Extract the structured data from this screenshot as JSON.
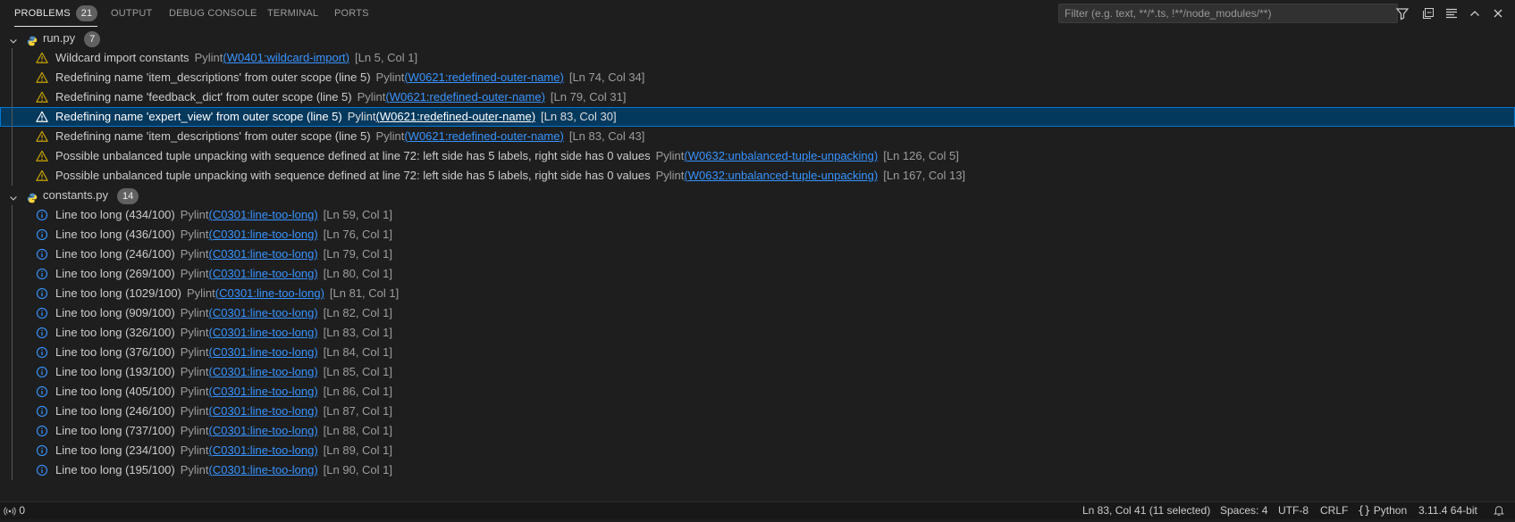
{
  "tabs": [
    {
      "label": "PROBLEMS",
      "badge": "21",
      "active": true
    },
    {
      "label": "OUTPUT"
    },
    {
      "label": "DEBUG CONSOLE"
    },
    {
      "label": "TERMINAL"
    },
    {
      "label": "PORTS"
    }
  ],
  "filter": {
    "placeholder": "Filter (e.g. text, **/*.ts, !**/node_modules/**)",
    "value": ""
  },
  "header_icons": [
    "filter-icon",
    "collapse-all-icon",
    "view-as-list-icon",
    "maximize-panel-icon",
    "close-panel-icon"
  ],
  "files": [
    {
      "name": "run.py",
      "count": "7",
      "expanded": true,
      "problems": [
        {
          "severity": "warning",
          "message": "Wildcard import constants",
          "source": "Pylint",
          "code": "W0401:wildcard-import",
          "location": "[Ln 5, Col 1]"
        },
        {
          "severity": "warning",
          "message": "Redefining name 'item_descriptions' from outer scope (line 5)",
          "source": "Pylint",
          "code": "W0621:redefined-outer-name",
          "location": "[Ln 74, Col 34]"
        },
        {
          "severity": "warning",
          "message": "Redefining name 'feedback_dict' from outer scope (line 5)",
          "source": "Pylint",
          "code": "W0621:redefined-outer-name",
          "location": "[Ln 79, Col 31]"
        },
        {
          "severity": "warning",
          "message": "Redefining name 'expert_view' from outer scope (line 5)",
          "source": "Pylint",
          "code": "W0621:redefined-outer-name",
          "location": "[Ln 83, Col 30]",
          "selected": true
        },
        {
          "severity": "warning",
          "message": "Redefining name 'item_descriptions' from outer scope (line 5)",
          "source": "Pylint",
          "code": "W0621:redefined-outer-name",
          "location": "[Ln 83, Col 43]"
        },
        {
          "severity": "warning",
          "message": "Possible unbalanced tuple unpacking with sequence defined at line 72: left side has 5 labels, right side has 0 values",
          "source": "Pylint",
          "code": "W0632:unbalanced-tuple-unpacking",
          "location": "[Ln 126, Col 5]"
        },
        {
          "severity": "warning",
          "message": "Possible unbalanced tuple unpacking with sequence defined at line 72: left side has 5 labels, right side has 0 values",
          "source": "Pylint",
          "code": "W0632:unbalanced-tuple-unpacking",
          "location": "[Ln 167, Col 13]"
        }
      ]
    },
    {
      "name": "constants.py",
      "count": "14",
      "expanded": true,
      "problems": [
        {
          "severity": "info",
          "message": "Line too long (434/100)",
          "source": "Pylint",
          "code": "C0301:line-too-long",
          "location": "[Ln 59, Col 1]"
        },
        {
          "severity": "info",
          "message": "Line too long (436/100)",
          "source": "Pylint",
          "code": "C0301:line-too-long",
          "location": "[Ln 76, Col 1]"
        },
        {
          "severity": "info",
          "message": "Line too long (246/100)",
          "source": "Pylint",
          "code": "C0301:line-too-long",
          "location": "[Ln 79, Col 1]"
        },
        {
          "severity": "info",
          "message": "Line too long (269/100)",
          "source": "Pylint",
          "code": "C0301:line-too-long",
          "location": "[Ln 80, Col 1]"
        },
        {
          "severity": "info",
          "message": "Line too long (1029/100)",
          "source": "Pylint",
          "code": "C0301:line-too-long",
          "location": "[Ln 81, Col 1]"
        },
        {
          "severity": "info",
          "message": "Line too long (909/100)",
          "source": "Pylint",
          "code": "C0301:line-too-long",
          "location": "[Ln 82, Col 1]"
        },
        {
          "severity": "info",
          "message": "Line too long (326/100)",
          "source": "Pylint",
          "code": "C0301:line-too-long",
          "location": "[Ln 83, Col 1]"
        },
        {
          "severity": "info",
          "message": "Line too long (376/100)",
          "source": "Pylint",
          "code": "C0301:line-too-long",
          "location": "[Ln 84, Col 1]"
        },
        {
          "severity": "info",
          "message": "Line too long (193/100)",
          "source": "Pylint",
          "code": "C0301:line-too-long",
          "location": "[Ln 85, Col 1]"
        },
        {
          "severity": "info",
          "message": "Line too long (405/100)",
          "source": "Pylint",
          "code": "C0301:line-too-long",
          "location": "[Ln 86, Col 1]"
        },
        {
          "severity": "info",
          "message": "Line too long (246/100)",
          "source": "Pylint",
          "code": "C0301:line-too-long",
          "location": "[Ln 87, Col 1]"
        },
        {
          "severity": "info",
          "message": "Line too long (737/100)",
          "source": "Pylint",
          "code": "C0301:line-too-long",
          "location": "[Ln 88, Col 1]"
        },
        {
          "severity": "info",
          "message": "Line too long (234/100)",
          "source": "Pylint",
          "code": "C0301:line-too-long",
          "location": "[Ln 89, Col 1]"
        },
        {
          "severity": "info",
          "message": "Line too long (195/100)",
          "source": "Pylint",
          "code": "C0301:line-too-long",
          "location": "[Ln 90, Col 1]"
        }
      ]
    }
  ],
  "statusbar": {
    "ports": "0",
    "cursor": "Ln 83, Col 41 (11 selected)",
    "spaces": "Spaces: 4",
    "encoding": "UTF-8",
    "eol": "CRLF",
    "language": "Python",
    "interpreter": "3.11.4 64-bit"
  },
  "colors": {
    "warning": "#cca700",
    "info": "#3794ff",
    "selection": "#04395e",
    "link": "#3794ff",
    "python_blue": "#4b8bbe",
    "python_yellow": "#ffd43b"
  }
}
